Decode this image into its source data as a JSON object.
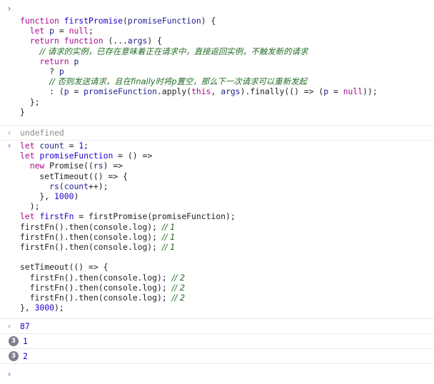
{
  "icons": {
    "input_prompt": "›",
    "result_arrow": "‹",
    "input_prompt_icon": "chevron-right-icon",
    "result_arrow_icon": "chevron-left-icon"
  },
  "entries": {
    "input1": {
      "lines": [
        [
          {
            "t": "kw",
            "v": "function "
          },
          {
            "t": "fn",
            "v": "firstPromise"
          },
          {
            "t": "tx",
            "v": "("
          },
          {
            "t": "id",
            "v": "promiseFunction"
          },
          {
            "t": "tx",
            "v": ") {"
          }
        ],
        [
          {
            "t": "tx",
            "v": "  "
          },
          {
            "t": "kw",
            "v": "let "
          },
          {
            "t": "id",
            "v": "p"
          },
          {
            "t": "tx",
            "v": " = "
          },
          {
            "t": "kw",
            "v": "null"
          },
          {
            "t": "tx",
            "v": ";"
          }
        ],
        [
          {
            "t": "tx",
            "v": "  "
          },
          {
            "t": "kw",
            "v": "return function "
          },
          {
            "t": "tx",
            "v": "(..."
          },
          {
            "t": "id",
            "v": "args"
          },
          {
            "t": "tx",
            "v": ") {"
          }
        ],
        [
          {
            "t": "tx",
            "v": "    "
          },
          {
            "t": "cm",
            "v": "// 请求的实例，已存在意味着正在请求中，直接返回实例，不触发新的请求"
          }
        ],
        [
          {
            "t": "tx",
            "v": "    "
          },
          {
            "t": "kw",
            "v": "return "
          },
          {
            "t": "id",
            "v": "p"
          }
        ],
        [
          {
            "t": "tx",
            "v": "      ? "
          },
          {
            "t": "id",
            "v": "p"
          }
        ],
        [
          {
            "t": "tx",
            "v": "      "
          },
          {
            "t": "cm",
            "v": "// 否则发送请求，且在finally时将p置空，那么下一次请求可以重新发起"
          }
        ],
        [
          {
            "t": "tx",
            "v": "      : ("
          },
          {
            "t": "id",
            "v": "p"
          },
          {
            "t": "tx",
            "v": " = "
          },
          {
            "t": "id",
            "v": "promiseFunction"
          },
          {
            "t": "tx",
            "v": ".apply("
          },
          {
            "t": "kw",
            "v": "this"
          },
          {
            "t": "tx",
            "v": ", "
          },
          {
            "t": "id",
            "v": "args"
          },
          {
            "t": "tx",
            "v": ").finally(() => ("
          },
          {
            "t": "id",
            "v": "p"
          },
          {
            "t": "tx",
            "v": " = "
          },
          {
            "t": "kw",
            "v": "null"
          },
          {
            "t": "tx",
            "v": "));"
          }
        ],
        [
          {
            "t": "tx",
            "v": "  };"
          }
        ],
        [
          {
            "t": "tx",
            "v": "}"
          }
        ]
      ]
    },
    "result1": {
      "value": "undefined"
    },
    "input2": {
      "lines": [
        [
          {
            "t": "kw",
            "v": "let "
          },
          {
            "t": "id",
            "v": "count"
          },
          {
            "t": "tx",
            "v": " = "
          },
          {
            "t": "nm",
            "v": "1"
          },
          {
            "t": "tx",
            "v": ";"
          }
        ],
        [
          {
            "t": "kw",
            "v": "let "
          },
          {
            "t": "fn",
            "v": "promiseFunction"
          },
          {
            "t": "tx",
            "v": " = () =>"
          }
        ],
        [
          {
            "t": "tx",
            "v": "  "
          },
          {
            "t": "kw",
            "v": "new "
          },
          {
            "t": "tx",
            "v": "Promise(("
          },
          {
            "t": "id",
            "v": "rs"
          },
          {
            "t": "tx",
            "v": ") =>"
          }
        ],
        [
          {
            "t": "tx",
            "v": "    setTimeout(() => {"
          }
        ],
        [
          {
            "t": "tx",
            "v": "      "
          },
          {
            "t": "id",
            "v": "rs"
          },
          {
            "t": "tx",
            "v": "("
          },
          {
            "t": "id",
            "v": "count"
          },
          {
            "t": "tx",
            "v": "++);"
          }
        ],
        [
          {
            "t": "tx",
            "v": "    }, "
          },
          {
            "t": "nm",
            "v": "1000"
          },
          {
            "t": "tx",
            "v": ")"
          }
        ],
        [
          {
            "t": "tx",
            "v": "  );"
          }
        ],
        [
          {
            "t": "kw",
            "v": "let "
          },
          {
            "t": "fn",
            "v": "firstFn"
          },
          {
            "t": "tx",
            "v": " = firstPromise(promiseFunction);"
          }
        ],
        [
          {
            "t": "tx",
            "v": "firstFn().then(console.log); "
          },
          {
            "t": "cm",
            "v": "// 1"
          }
        ],
        [
          {
            "t": "tx",
            "v": "firstFn().then(console.log); "
          },
          {
            "t": "cm",
            "v": "// 1"
          }
        ],
        [
          {
            "t": "tx",
            "v": "firstFn().then(console.log); "
          },
          {
            "t": "cm",
            "v": "// 1"
          }
        ],
        [
          {
            "t": "tx",
            "v": ""
          }
        ],
        [
          {
            "t": "tx",
            "v": "setTimeout(() => {"
          }
        ],
        [
          {
            "t": "tx",
            "v": "  firstFn().then(console.log); "
          },
          {
            "t": "cm",
            "v": "// 2"
          }
        ],
        [
          {
            "t": "tx",
            "v": "  firstFn().then(console.log); "
          },
          {
            "t": "cm",
            "v": "// 2"
          }
        ],
        [
          {
            "t": "tx",
            "v": "  firstFn().then(console.log); "
          },
          {
            "t": "cm",
            "v": "// 2"
          }
        ],
        [
          {
            "t": "tx",
            "v": "}, "
          },
          {
            "t": "nm",
            "v": "3000"
          },
          {
            "t": "tx",
            "v": ");"
          }
        ]
      ]
    },
    "result2": {
      "value": "87"
    },
    "log1": {
      "count": "3",
      "value": "1"
    },
    "log2": {
      "count": "3",
      "value": "2"
    }
  }
}
